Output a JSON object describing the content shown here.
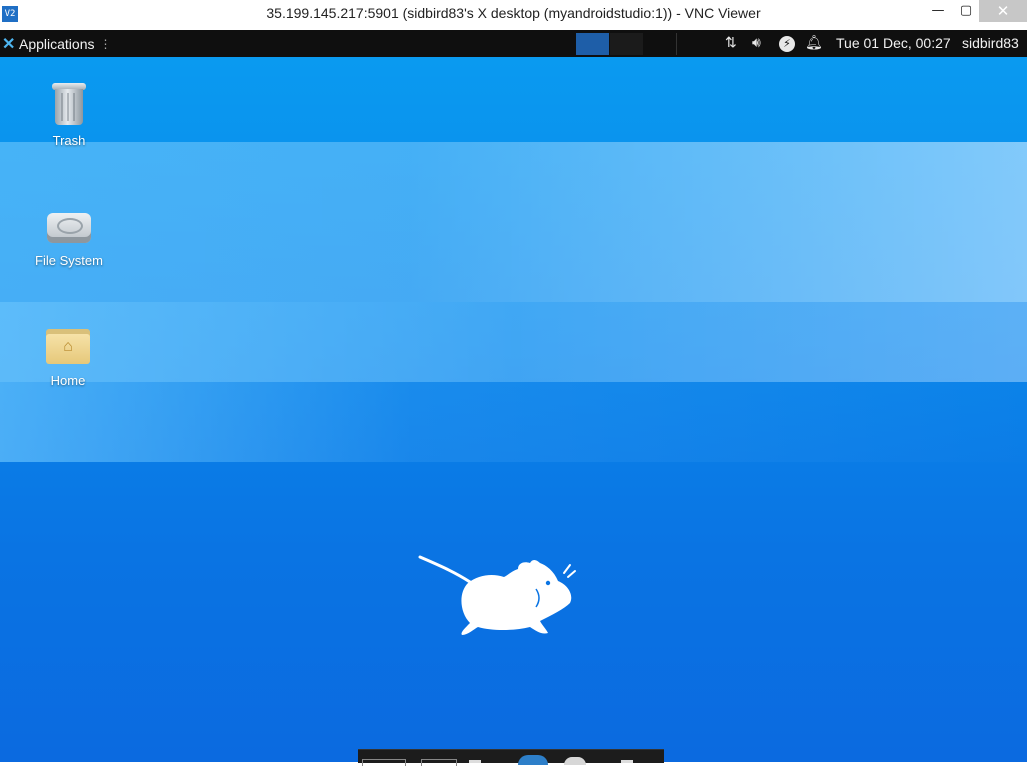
{
  "window": {
    "app_icon_text": "V2",
    "title": "35.199.145.217:5901 (sidbird83's X desktop (myandroidstudio:1)) - VNC Viewer",
    "controls": {
      "minimize": "—",
      "maximize": "▢",
      "close": "✕"
    }
  },
  "panel": {
    "applications_label": "Applications",
    "clock": "Tue 01 Dec, 00:27",
    "user": "sidbird83"
  },
  "desktop": {
    "icons": [
      {
        "label": "Trash"
      },
      {
        "label": "File System"
      },
      {
        "label": "Home"
      }
    ]
  },
  "colors": {
    "panel_bg": "#0f0f0f",
    "desktop_blue": "#0a86ea",
    "workspace_active": "#1e5ea8"
  }
}
